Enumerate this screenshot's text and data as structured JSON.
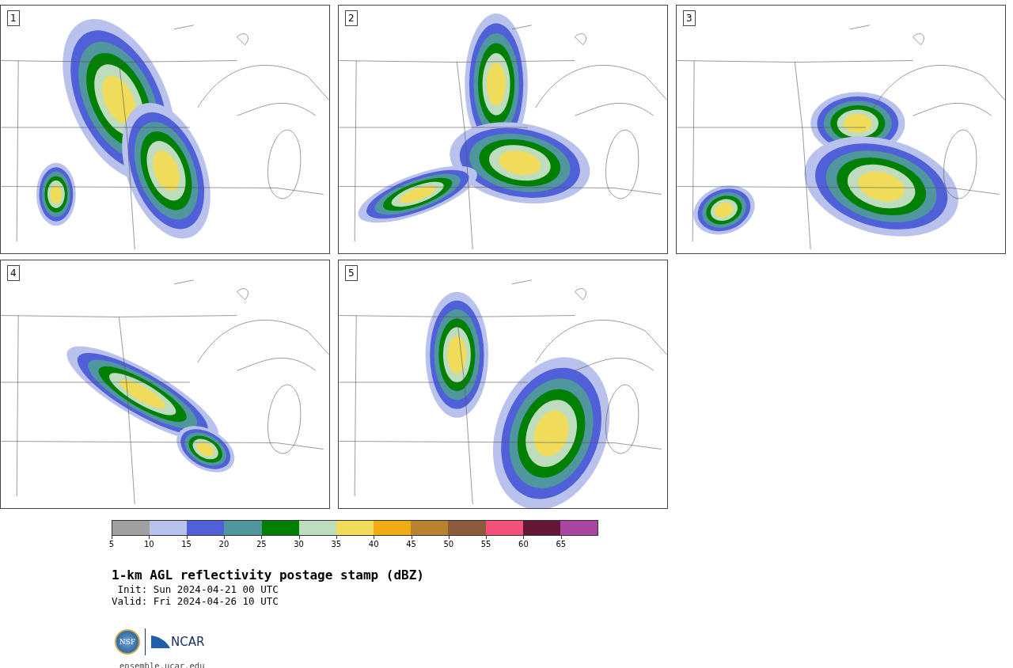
{
  "panels": [
    {
      "label": "1"
    },
    {
      "label": "2"
    },
    {
      "label": "3"
    },
    {
      "label": "4"
    },
    {
      "label": "5"
    }
  ],
  "colorbar": {
    "bins": [
      {
        "color": "#a0a0a0"
      },
      {
        "color": "#b8c2ec"
      },
      {
        "color": "#5060d8"
      },
      {
        "color": "#50969e"
      },
      {
        "color": "#008000"
      },
      {
        "color": "#bedcbe"
      },
      {
        "color": "#f0dc5a"
      },
      {
        "color": "#f0ac14"
      },
      {
        "color": "#b8822e"
      },
      {
        "color": "#8c5a3c"
      },
      {
        "color": "#f4507c"
      },
      {
        "color": "#641636"
      },
      {
        "color": "#aa46a2"
      }
    ],
    "ticks": [
      "5",
      "10",
      "15",
      "20",
      "25",
      "30",
      "35",
      "40",
      "45",
      "50",
      "55",
      "60",
      "65"
    ]
  },
  "title": "1-km AGL reflectivity postage stamp (dBZ)",
  "init": " Init: Sun 2024-04-21 00 UTC",
  "valid": "Valid: Fri 2024-04-26 10 UTC",
  "logo": {
    "nsf": "NSF",
    "ncar": "NCAR"
  },
  "url": "ensemble.ucar.edu"
}
